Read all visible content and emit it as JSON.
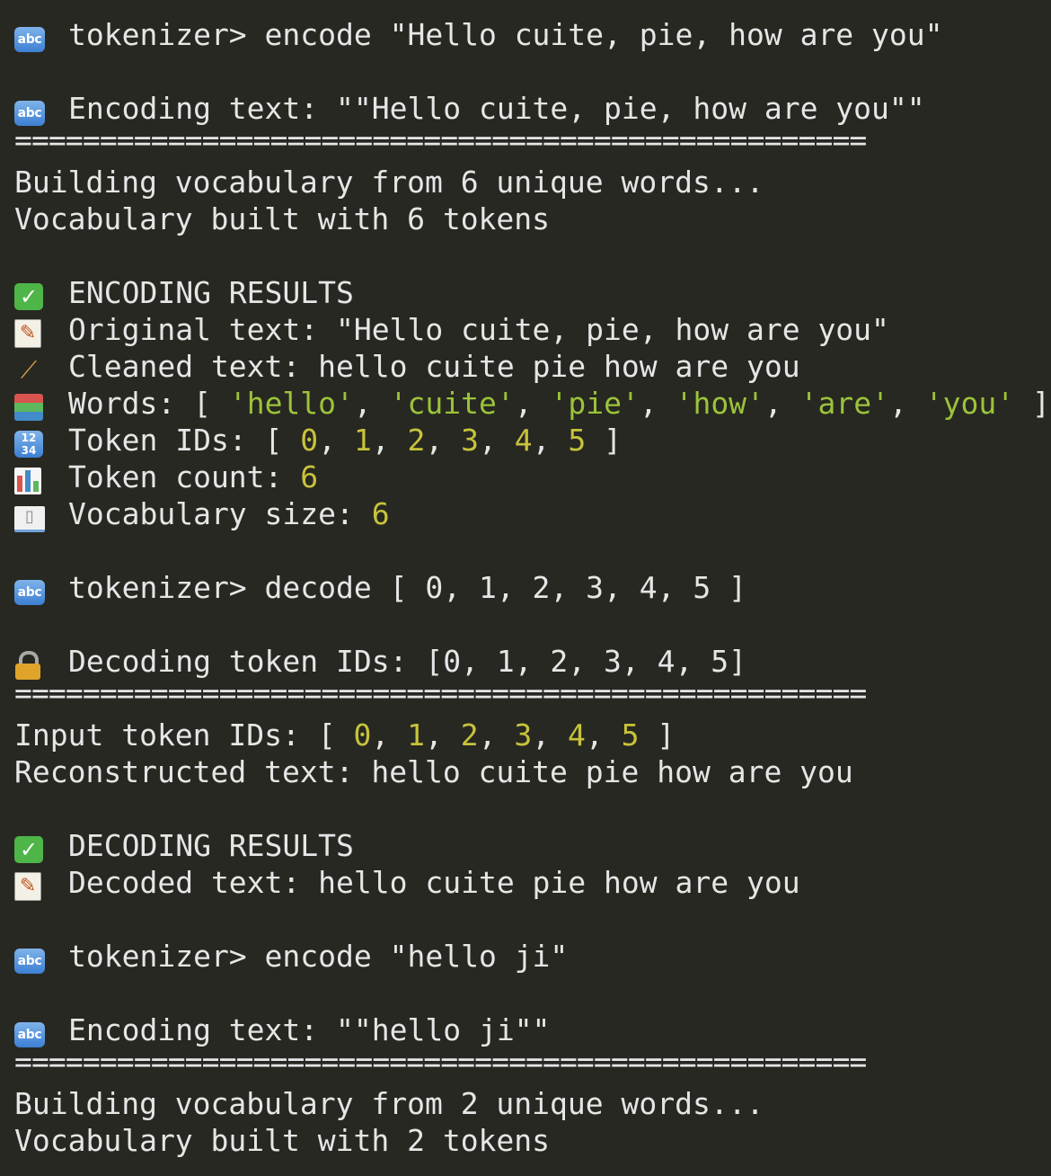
{
  "colors": {
    "background": "#272822",
    "text": "#e6e6e6",
    "number": "#c7c33b",
    "string": "#9cc33a"
  },
  "icons": {
    "abc": "abc",
    "check": "✓",
    "memo": "✎",
    "broom": "⟋",
    "numbers_top": "12",
    "numbers_bottom": "34",
    "book": "▯"
  },
  "separator": "==================================================",
  "session": {
    "cmd1": "tokenizer> encode \"Hello cuite, pie, how are you\"",
    "encoding1": "Encoding text: \"\"Hello cuite, pie, how are you\"\"",
    "building1": "Building vocabulary from 6 unique words...",
    "built1": "Vocabulary built with 6 tokens",
    "enc_results": {
      "header": "ENCODING RESULTS",
      "original_label": "Original text: ",
      "original_value": "\"Hello cuite, pie, how are you\"",
      "cleaned_label": "Cleaned text: ",
      "cleaned_value": "hello cuite pie how are you",
      "words_label": "Words: ",
      "words": [
        "'hello'",
        "'cuite'",
        "'pie'",
        "'how'",
        "'are'",
        "'you'"
      ],
      "token_ids_label": "Token IDs: ",
      "token_ids": [
        "0",
        "1",
        "2",
        "3",
        "4",
        "5"
      ],
      "count_label": "Token count: ",
      "count_value": "6",
      "vocab_label": "Vocabulary size: ",
      "vocab_value": "6"
    },
    "cmd2": "tokenizer> decode [ 0, 1, 2, 3, 4, 5 ]",
    "decoding": "Decoding token IDs: [0, 1, 2, 3, 4, 5]",
    "input_label": "Input token IDs: ",
    "input_ids": [
      "0",
      "1",
      "2",
      "3",
      "4",
      "5"
    ],
    "reconstructed": "Reconstructed text: hello cuite pie how are you",
    "dec_results": {
      "header": "DECODING RESULTS",
      "decoded": "Decoded text: hello cuite pie how are you"
    },
    "cmd3": "tokenizer> encode \"hello ji\"",
    "encoding2": "Encoding text: \"\"hello ji\"\"",
    "building2": "Building vocabulary from 2 unique words...",
    "built2": "Vocabulary built with 2 tokens"
  }
}
